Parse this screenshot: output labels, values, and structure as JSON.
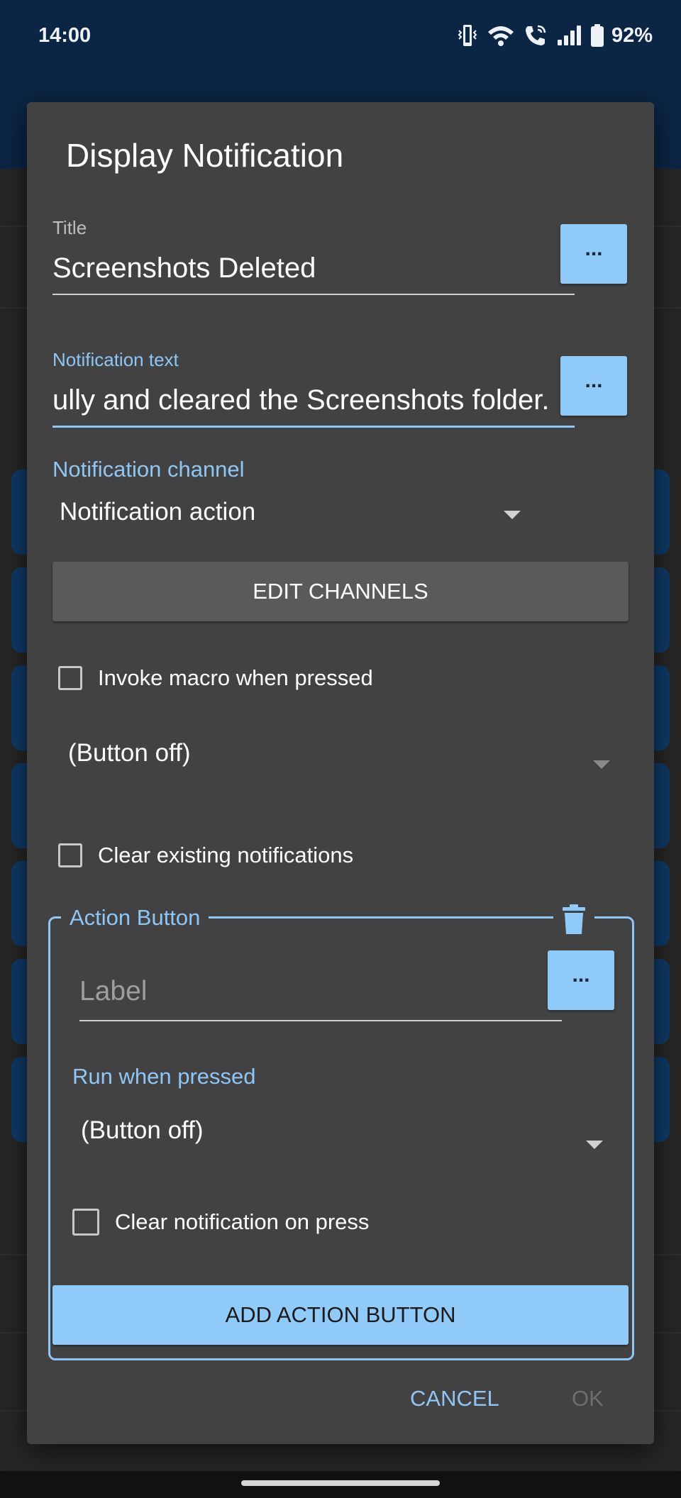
{
  "status_bar": {
    "time": "14:00",
    "battery_percent": "92%",
    "icons": [
      "vibrate-icon",
      "wifi-icon",
      "wifi-calling-icon",
      "cell-signal-icon",
      "battery-icon"
    ]
  },
  "dialog": {
    "title": "Display Notification",
    "title_field": {
      "label": "Title",
      "value": "Screenshots Deleted",
      "insert_button": "..."
    },
    "text_field": {
      "label": "Notification text",
      "value": "ully and cleared the Screenshots folder.",
      "insert_button": "..."
    },
    "channel": {
      "label": "Notification channel",
      "selected": "Notification action",
      "edit_button": "EDIT CHANNELS"
    },
    "invoke_macro": {
      "label": "Invoke macro when pressed",
      "checked": false,
      "selected": "(Button off)"
    },
    "clear_existing": {
      "label": "Clear existing notifications",
      "checked": false
    },
    "action_button": {
      "legend": "Action Button",
      "label_placeholder": "Label",
      "insert_button": "...",
      "run_label": "Run when pressed",
      "run_selected": "(Button off)",
      "clear_on_press_label": "Clear notification on press",
      "clear_on_press_checked": false
    },
    "add_action_button": "ADD ACTION BUTTON",
    "cancel": "CANCEL",
    "ok": "OK"
  },
  "colors": {
    "accent": "#90caf9",
    "dialog_bg": "#424242",
    "status_bar_bg": "#0b2645"
  }
}
